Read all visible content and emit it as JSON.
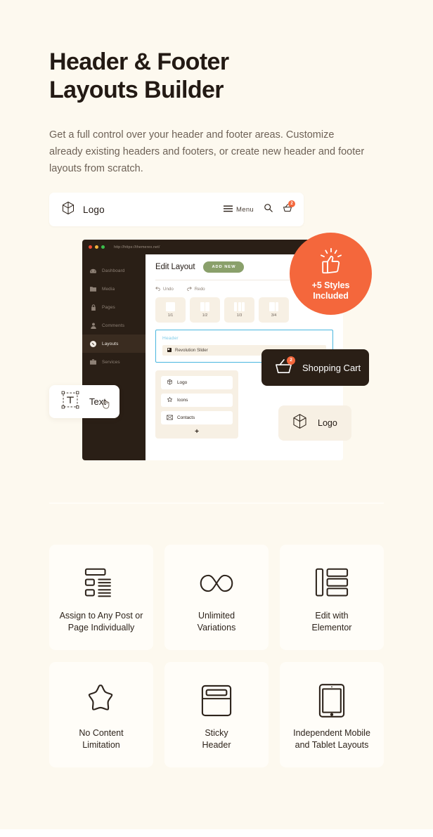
{
  "colors": {
    "page_bg": "#FDF9EF",
    "accent_orange": "#F4673C",
    "dark_brown": "#2A1F16",
    "green_button": "#8AA06B",
    "blue_outline": "#49B6DF",
    "card_bg": "#FFFDF8",
    "cream_panel": "#F7F0E4"
  },
  "hero": {
    "title": "Header & Footer\nLayouts Builder",
    "subtitle": "Get a full control over your header and footer areas. Customize already existing headers and footers, or create new header and footer layouts from scratch."
  },
  "header_preview": {
    "logo_icon": "cube-icon",
    "logo_label": "Logo",
    "menu_icon": "hamburger-icon",
    "menu_label": "Menu",
    "search_icon": "search-icon",
    "cart_icon": "cart-icon",
    "cart_count": "2"
  },
  "browser_mockup": {
    "url": "http://https://themerex.net/",
    "traffic_lights": [
      "red",
      "yellow",
      "green"
    ],
    "sidebar": [
      {
        "label": "Dashboard",
        "icon": "dashboard-icon",
        "active": false
      },
      {
        "label": "Media",
        "icon": "media-icon",
        "active": false
      },
      {
        "label": "Pages",
        "icon": "lock-icon",
        "active": false
      },
      {
        "label": "Comments",
        "icon": "user-icon",
        "active": false
      },
      {
        "label": "Layouts",
        "icon": "layouts-icon",
        "active": true
      },
      {
        "label": "Services",
        "icon": "briefcase-icon",
        "active": false
      }
    ],
    "page_title": "Edit Layout",
    "add_new_label": "ADD NEW",
    "undo_label": "Undo",
    "undo_icon": "undo-icon",
    "redo_label": "Redo",
    "redo_icon": "redo-icon",
    "column_presets": [
      {
        "label": "1/1",
        "segments": 1
      },
      {
        "label": "1/2",
        "segments": 2
      },
      {
        "label": "1/3",
        "segments": 3
      },
      {
        "label": "3/4",
        "segments": 2
      }
    ],
    "header_section": {
      "title": "Header",
      "row_label": "Revolution Slider",
      "row_icon": "slider-icon"
    },
    "widgets": [
      {
        "label": "Logo",
        "icon": "cube-icon"
      },
      {
        "label": "Icons",
        "icon": "star-icon"
      },
      {
        "label": "Contacts",
        "icon": "envelope-icon"
      }
    ],
    "add_widget_label": "+"
  },
  "floating": {
    "styles_badge": {
      "icon": "thumbs-up-icon",
      "text": "+5 Styles\nIncluded"
    },
    "text_chip": {
      "label": "Text",
      "icon": "text-tool-icon",
      "cursor_icon": "grab-hand-cursor-icon"
    },
    "cart_chip": {
      "label": "Shopping Cart",
      "icon": "cart-icon",
      "count": "2"
    },
    "logo_chip": {
      "label": "Logo",
      "icon": "cube-icon"
    }
  },
  "features": [
    {
      "icon": "list-layout-icon",
      "caption": "Assign to Any Post or\nPage Individually"
    },
    {
      "icon": "infinity-icon",
      "caption": "Unlimited\nVariations"
    },
    {
      "icon": "sidebar-list-icon",
      "caption": "Edit with\nElementor"
    },
    {
      "icon": "star-icon",
      "caption": "No Content\nLimitation"
    },
    {
      "icon": "sticky-header-icon",
      "caption": "Sticky\nHeader"
    },
    {
      "icon": "tablet-icon",
      "caption": "Independent Mobile\nand Tablet Layouts"
    }
  ]
}
